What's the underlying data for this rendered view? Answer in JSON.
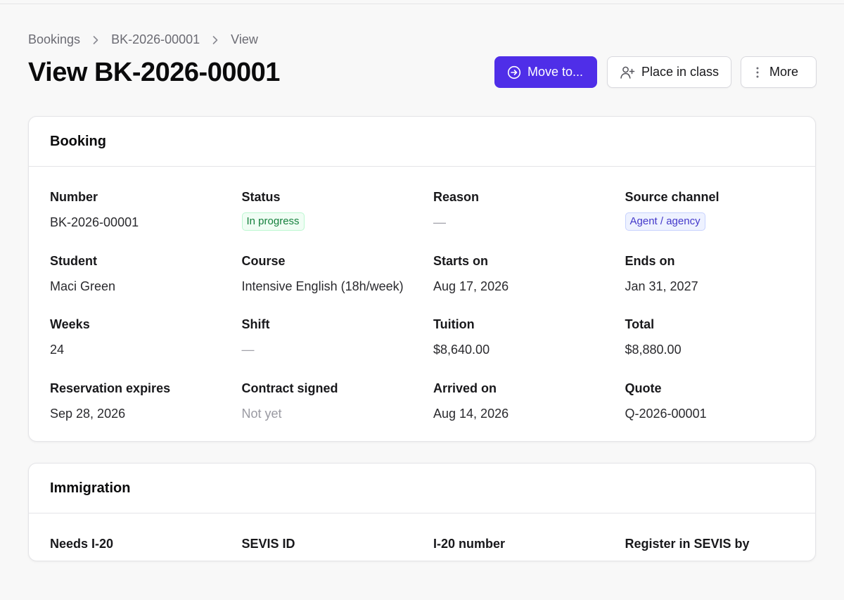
{
  "breadcrumb": {
    "items": [
      "Bookings",
      "BK-2026-00001",
      "View"
    ]
  },
  "page_title": "View BK-2026-00001",
  "actions": {
    "move_to": "Move to...",
    "place_in_class": "Place in class",
    "more": "More"
  },
  "colors": {
    "primary": "#4f2ee8",
    "status_green": "#15803d",
    "channel_indigo": "#4338ca"
  },
  "booking": {
    "title": "Booking",
    "fields": [
      {
        "label": "Number",
        "value": "BK-2026-00001"
      },
      {
        "label": "Status",
        "value": "In progress"
      },
      {
        "label": "Reason",
        "value": "—"
      },
      {
        "label": "Source channel",
        "value": "Agent / agency"
      },
      {
        "label": "Student",
        "value": "Maci Green"
      },
      {
        "label": "Course",
        "value": "Intensive English (18h/week)"
      },
      {
        "label": "Starts on",
        "value": "Aug 17, 2026"
      },
      {
        "label": "Ends on",
        "value": "Jan 31, 2027"
      },
      {
        "label": "Weeks",
        "value": "24"
      },
      {
        "label": "Shift",
        "value": "—"
      },
      {
        "label": "Tuition",
        "value": "$8,640.00"
      },
      {
        "label": "Total",
        "value": "$8,880.00"
      },
      {
        "label": "Reservation expires",
        "value": "Sep 28, 2026"
      },
      {
        "label": "Contract signed",
        "value": "Not yet"
      },
      {
        "label": "Arrived on",
        "value": "Aug 14, 2026"
      },
      {
        "label": "Quote",
        "value": "Q-2026-00001"
      }
    ]
  },
  "immigration": {
    "title": "Immigration",
    "fields": [
      {
        "label": "Needs I-20"
      },
      {
        "label": "SEVIS ID"
      },
      {
        "label": "I-20 number"
      },
      {
        "label": "Register in SEVIS by"
      }
    ]
  }
}
